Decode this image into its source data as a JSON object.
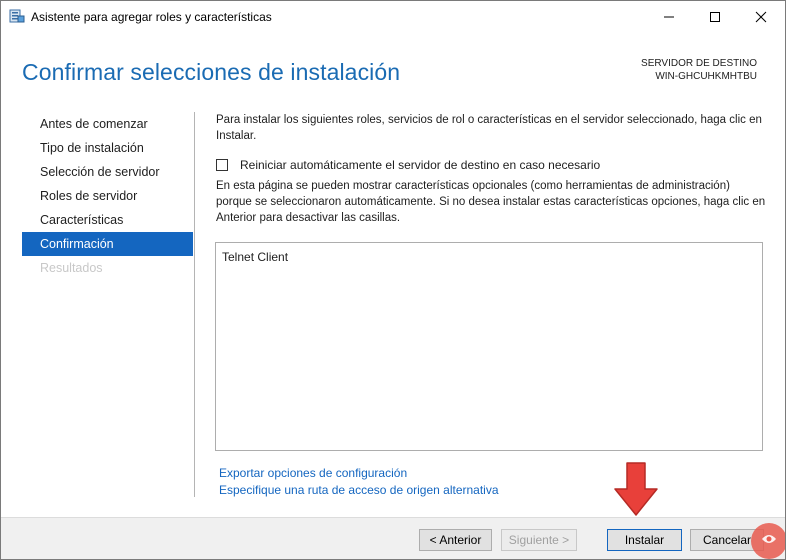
{
  "window": {
    "title": "Asistente para agregar roles y características",
    "app_icon": "server-manager-icon",
    "controls": [
      "minimize-icon",
      "maximize-icon",
      "close-icon"
    ]
  },
  "header": {
    "page_title": "Confirmar selecciones de instalación",
    "server_caption": "SERVIDOR DE DESTINO",
    "server_name": "WIN-GHCUHKMHTBU"
  },
  "sidebar": {
    "items": [
      {
        "label": "Antes de comenzar",
        "state": "normal"
      },
      {
        "label": "Tipo de instalación",
        "state": "normal"
      },
      {
        "label": "Selección de servidor",
        "state": "normal"
      },
      {
        "label": "Roles de servidor",
        "state": "normal"
      },
      {
        "label": "Características",
        "state": "normal"
      },
      {
        "label": "Confirmación",
        "state": "active"
      },
      {
        "label": "Resultados",
        "state": "disabled"
      }
    ]
  },
  "main": {
    "intro": "Para instalar los siguientes roles, servicios de rol o características en el servidor seleccionado, haga clic en Instalar.",
    "restart_checkbox": {
      "label": "Reiniciar automáticamente el servidor de destino en caso necesario",
      "checked": false
    },
    "optional_note": "En esta página se pueden mostrar características opcionales (como herramientas de administración) porque se seleccionaron automáticamente. Si no desea instalar estas características opciones, haga clic en Anterior para desactivar las casillas.",
    "features": [
      "Telnet Client"
    ],
    "links": {
      "export": "Exportar opciones de configuración",
      "alternate_source": "Especifique una ruta de acceso de origen alternativa"
    }
  },
  "footer": {
    "previous": "< Anterior",
    "next": "Siguiente >",
    "install": "Instalar",
    "cancel": "Cancelar"
  },
  "colors": {
    "accent": "#1466c0",
    "title_blue": "#1a6bb3",
    "annotation_arrow": "#e8403a"
  }
}
